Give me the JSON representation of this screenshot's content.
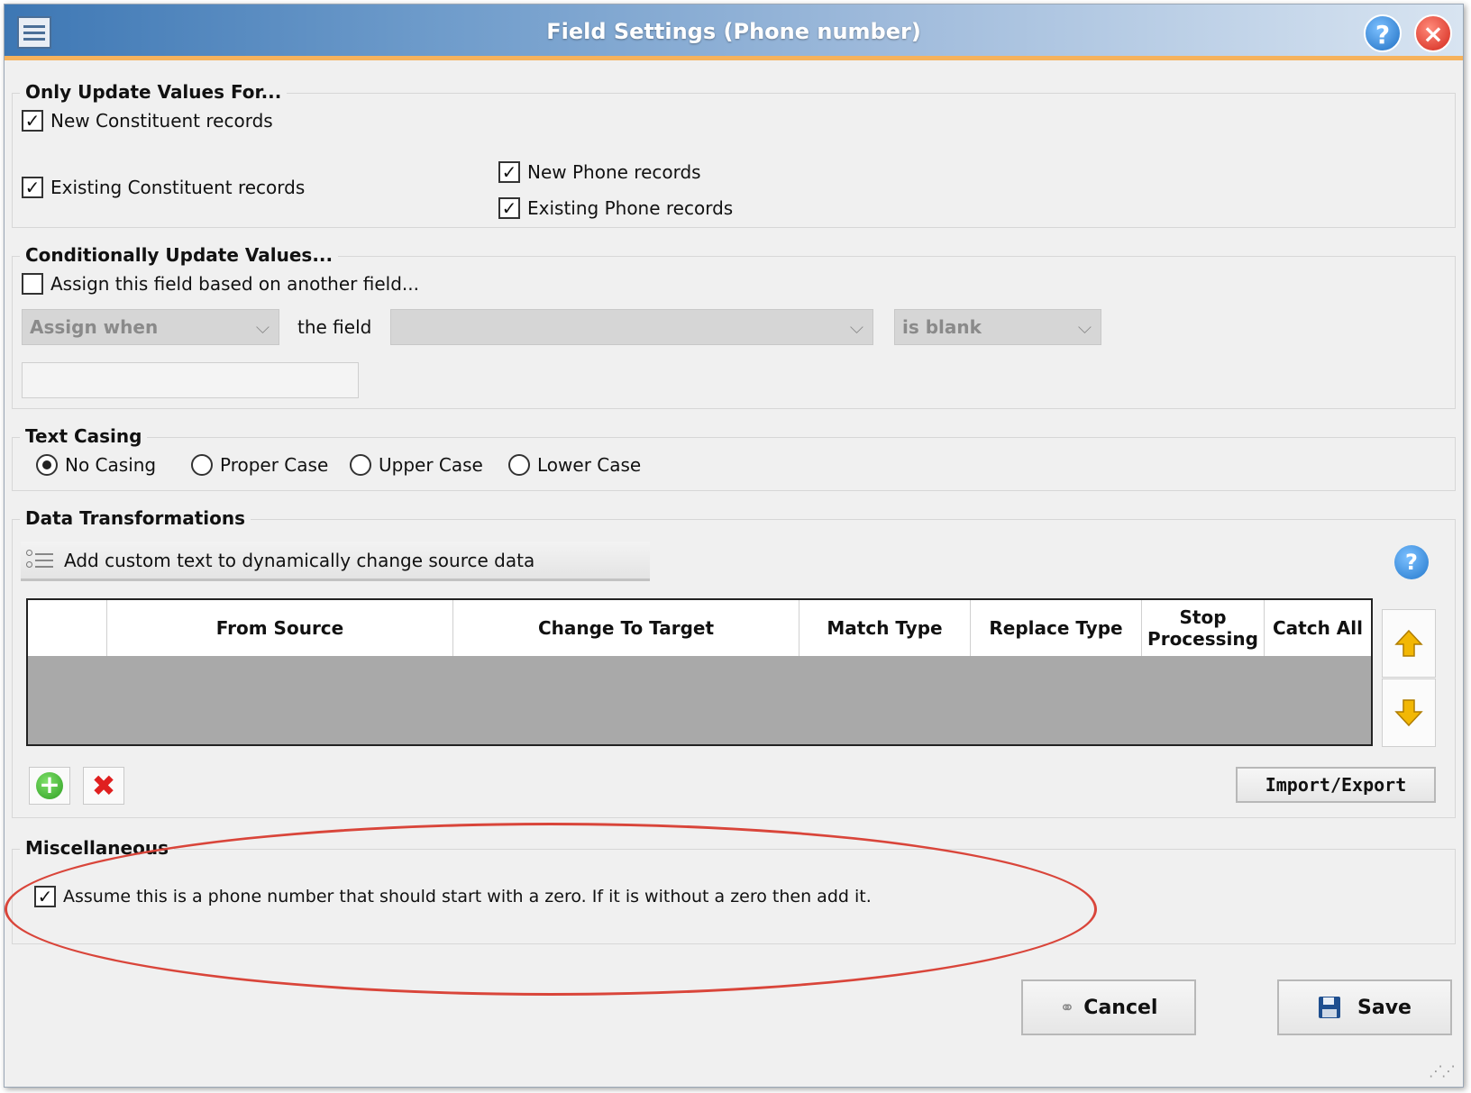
{
  "window": {
    "title": "Field Settings (Phone number)"
  },
  "only_update": {
    "legend": "Only Update Values For...",
    "new_constituent": {
      "label": "New Constituent records",
      "checked": true
    },
    "existing_constituent": {
      "label": "Existing Constituent records",
      "checked": true
    },
    "new_phone": {
      "label": "New Phone records",
      "checked": true
    },
    "existing_phone": {
      "label": "Existing Phone records",
      "checked": true
    }
  },
  "conditional": {
    "legend": "Conditionally Update Values...",
    "assign_based": {
      "label": "Assign this field based on another field...",
      "checked": false
    },
    "assign_when": "Assign when",
    "the_field": "the field",
    "field_value": "",
    "condition": "is blank",
    "value_input": ""
  },
  "text_casing": {
    "legend": "Text Casing",
    "options": [
      "No Casing",
      "Proper Case",
      "Upper Case",
      "Lower Case"
    ],
    "selected": "No Casing"
  },
  "transformations": {
    "legend": "Data Transformations",
    "add_custom_text_label": "Add custom text to dynamically change source data",
    "columns": [
      "",
      "From Source",
      "Change To Target",
      "Match Type",
      "Replace Type",
      "Stop Processing",
      "Catch All"
    ],
    "rows": [],
    "import_export_label": "Import/Export"
  },
  "miscellaneous": {
    "legend": "Miscellaneous",
    "leading_zero": {
      "label": "Assume this is a phone number that should start with a zero. If it is without a zero then add it.",
      "checked": true
    }
  },
  "footer": {
    "cancel_label": "Cancel",
    "save_label": "Save"
  },
  "icons": {
    "help": "?",
    "close": "×",
    "check": "✓",
    "chevron": "⌵",
    "arrow_up": "up-arrow-icon",
    "arrow_down": "down-arrow-icon"
  },
  "colors": {
    "title_gradient_start": "#3d77b4",
    "title_accent": "#f6b25c",
    "grid_body": "#a9a9a9",
    "annotation": "#d9453a",
    "arrow": "#f2b705"
  }
}
